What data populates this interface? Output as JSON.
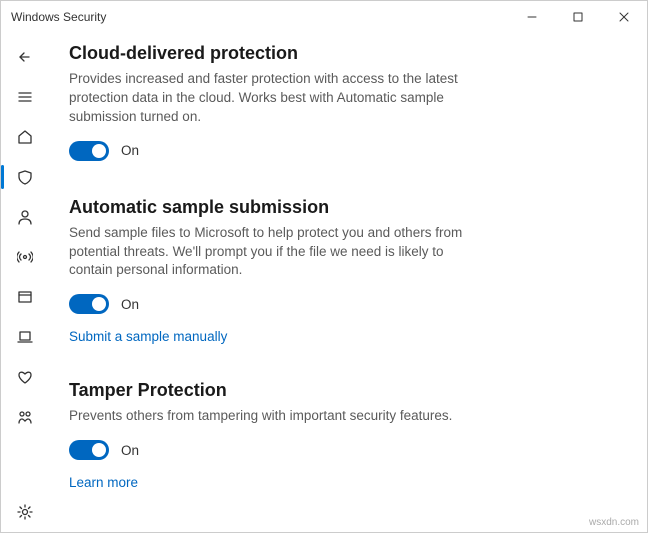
{
  "window": {
    "title": "Windows Security"
  },
  "sections": {
    "cloud": {
      "title": "Cloud-delivered protection",
      "desc": "Provides increased and faster protection with access to the latest protection data in the cloud. Works best with Automatic sample submission turned on.",
      "toggle_state": "On"
    },
    "sample": {
      "title": "Automatic sample submission",
      "desc": "Send sample files to Microsoft to help protect you and others from potential threats. We'll prompt you if the file we need is likely to contain personal information.",
      "toggle_state": "On",
      "link": "Submit a sample manually"
    },
    "tamper": {
      "title": "Tamper Protection",
      "desc": "Prevents others from tampering with important security features.",
      "toggle_state": "On",
      "link": "Learn more"
    }
  },
  "watermark": "wsxdn.com"
}
